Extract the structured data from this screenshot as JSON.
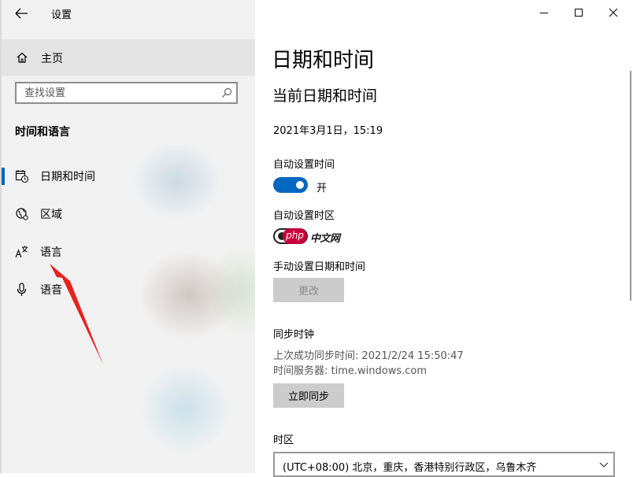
{
  "window": {
    "title": "设置",
    "controls": {
      "minimize": "minimize-icon",
      "maximize": "maximize-icon",
      "close": "close-icon"
    }
  },
  "sidebar": {
    "home_label": "主页",
    "search": {
      "placeholder": "查找设置",
      "value": ""
    },
    "section_heading": "时间和语言",
    "items": [
      {
        "label": "日期和时间",
        "icon": "calendar-clock-icon",
        "selected": true
      },
      {
        "label": "区域",
        "icon": "globe-icon",
        "selected": false
      },
      {
        "label": "语言",
        "icon": "language-icon",
        "selected": false
      },
      {
        "label": "语音",
        "icon": "microphone-icon",
        "selected": false
      }
    ]
  },
  "main": {
    "page_title": "日期和时间",
    "section_title": "当前日期和时间",
    "current_datetime": "2021年3月1日，15:19",
    "auto_time": {
      "label": "自动设置时间",
      "state_text": "开",
      "on": true
    },
    "auto_timezone": {
      "label": "自动设置时区",
      "on": false
    },
    "manual": {
      "label": "手动设置日期和时间",
      "button": "更改"
    },
    "sync": {
      "label": "同步时钟",
      "last_sync": "上次成功同步时间: 2021/2/24 15:50:47",
      "server": "时间服务器: time.windows.com",
      "button": "立即同步"
    },
    "timezone": {
      "label": "时区",
      "value": "(UTC+08:00) 北京，重庆，香港特别行政区，乌鲁木齐"
    }
  },
  "watermark": {
    "pill_text": "php",
    "text": "中文网"
  },
  "colors": {
    "accent": "#0067c0",
    "annotation_arrow": "#e8211d",
    "sidebar_bg": "#f1f1f1"
  }
}
